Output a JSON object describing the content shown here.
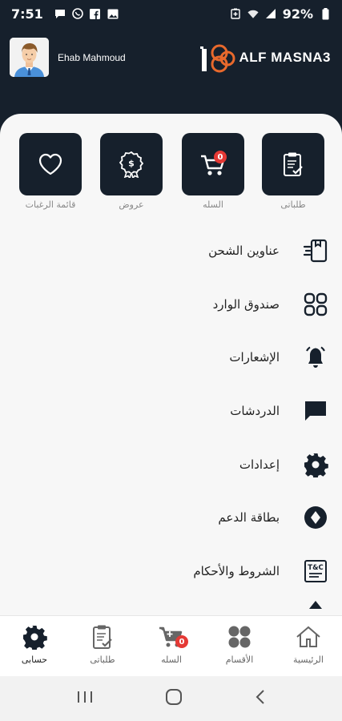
{
  "status_bar": {
    "time": "7:51",
    "battery": "92%",
    "left_icons": [
      "message-icon",
      "whatsapp-icon",
      "facebook-icon",
      "gallery-icon"
    ],
    "right_icons": [
      "battery-saver-icon",
      "wifi-icon",
      "signal-icon",
      "battery-icon"
    ]
  },
  "header": {
    "user_name": "Ehab Mahmoud",
    "logo_text": "ALF MASNA3",
    "logo_mark": "1"
  },
  "quick_actions": [
    {
      "label": "طلباتى",
      "icon": "orders-clipboard-icon"
    },
    {
      "label": "السله",
      "icon": "cart-icon",
      "badge": "0"
    },
    {
      "label": "عروض",
      "icon": "offers-badge-icon"
    },
    {
      "label": "قائمة الرغبات",
      "icon": "heart-icon"
    }
  ],
  "menu": [
    {
      "label": "عناوين الشحن",
      "icon": "shipping-address-icon"
    },
    {
      "label": "صندوق الوارد",
      "icon": "inbox-grid-icon"
    },
    {
      "label": "الإشعارات",
      "icon": "bell-icon"
    },
    {
      "label": "الدردشات",
      "icon": "chat-icon"
    },
    {
      "label": "إعدادات",
      "icon": "settings-gear-icon"
    },
    {
      "label": "بطاقة الدعم",
      "icon": "support-card-icon"
    },
    {
      "label": "الشروط والأحكام",
      "icon": "terms-icon",
      "icon_text": "T&C"
    }
  ],
  "bottom_nav": [
    {
      "label": "الرئيسية",
      "icon": "home-icon"
    },
    {
      "label": "الأقسام",
      "icon": "categories-icon"
    },
    {
      "label": "السله",
      "icon": "cart-add-icon",
      "badge": "0"
    },
    {
      "label": "طلباتى",
      "icon": "orders-clipboard-icon"
    },
    {
      "label": "حسابى",
      "icon": "account-gear-icon",
      "active": true
    }
  ],
  "colors": {
    "dark": "#16202c",
    "sheet": "#f7f7f7",
    "badge": "#e53935",
    "logo_orange": "#e8692c"
  }
}
